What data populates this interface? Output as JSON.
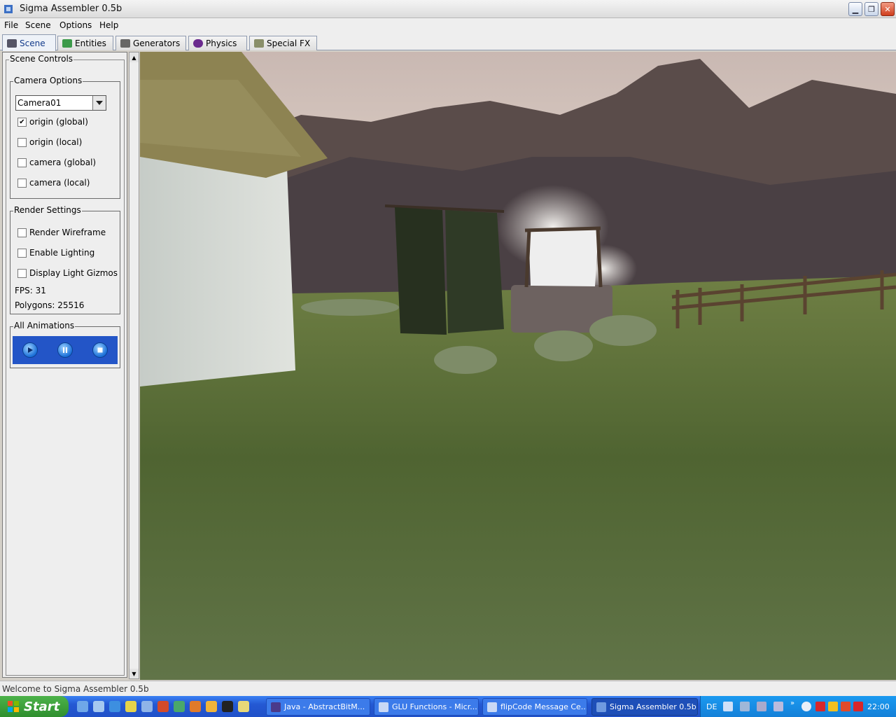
{
  "window": {
    "title": "Sigma Assembler 0.5b"
  },
  "menu": [
    "File",
    "Scene",
    "Options",
    "Help"
  ],
  "tabs": [
    {
      "label": "Scene",
      "icon": "scene-icon",
      "active": true
    },
    {
      "label": "Entities",
      "icon": "entities-icon",
      "active": false
    },
    {
      "label": "Generators",
      "icon": "generators-icon",
      "active": false
    },
    {
      "label": "Physics",
      "icon": "physics-icon",
      "active": false
    },
    {
      "label": "Special FX",
      "icon": "special-fx-icon",
      "active": false
    }
  ],
  "scene_controls": {
    "title": "Scene Controls",
    "camera_options": {
      "title": "Camera Options",
      "selected_camera": "Camera01",
      "checkboxes": [
        {
          "label": "origin (global)",
          "checked": true
        },
        {
          "label": "origin (local)",
          "checked": false
        },
        {
          "label": "camera (global)",
          "checked": false
        },
        {
          "label": "camera (local)",
          "checked": false
        }
      ]
    },
    "render_settings": {
      "title": "Render Settings",
      "checkboxes": [
        {
          "label": "Render Wireframe",
          "checked": false
        },
        {
          "label": "Enable Lighting",
          "checked": false
        },
        {
          "label": "Display Light Gizmos",
          "checked": false
        }
      ],
      "fps": "FPS: 31",
      "polygons": "Polygons: 25516"
    },
    "animations": {
      "title": "All Animations",
      "buttons": [
        "play-icon",
        "pause-icon",
        "stop-icon"
      ]
    }
  },
  "viewport": {
    "description_icon": "3d-viewport"
  },
  "status": "Welcome to Sigma Assembler 0.5b",
  "taskbar": {
    "start": "Start",
    "tasks": [
      {
        "label": "Java - AbstractBitM...",
        "active": false
      },
      {
        "label": "GLU Functions - Micr...",
        "active": false
      },
      {
        "label": "flipCode Message Ce...",
        "active": false
      },
      {
        "label": "Sigma Assembler 0.5b",
        "active": true
      }
    ],
    "lang": "DE",
    "clock": "22:00"
  },
  "colors": {
    "accent": "#2355c7",
    "taskbar": "#2458d3",
    "panel": "#eeeeee"
  }
}
